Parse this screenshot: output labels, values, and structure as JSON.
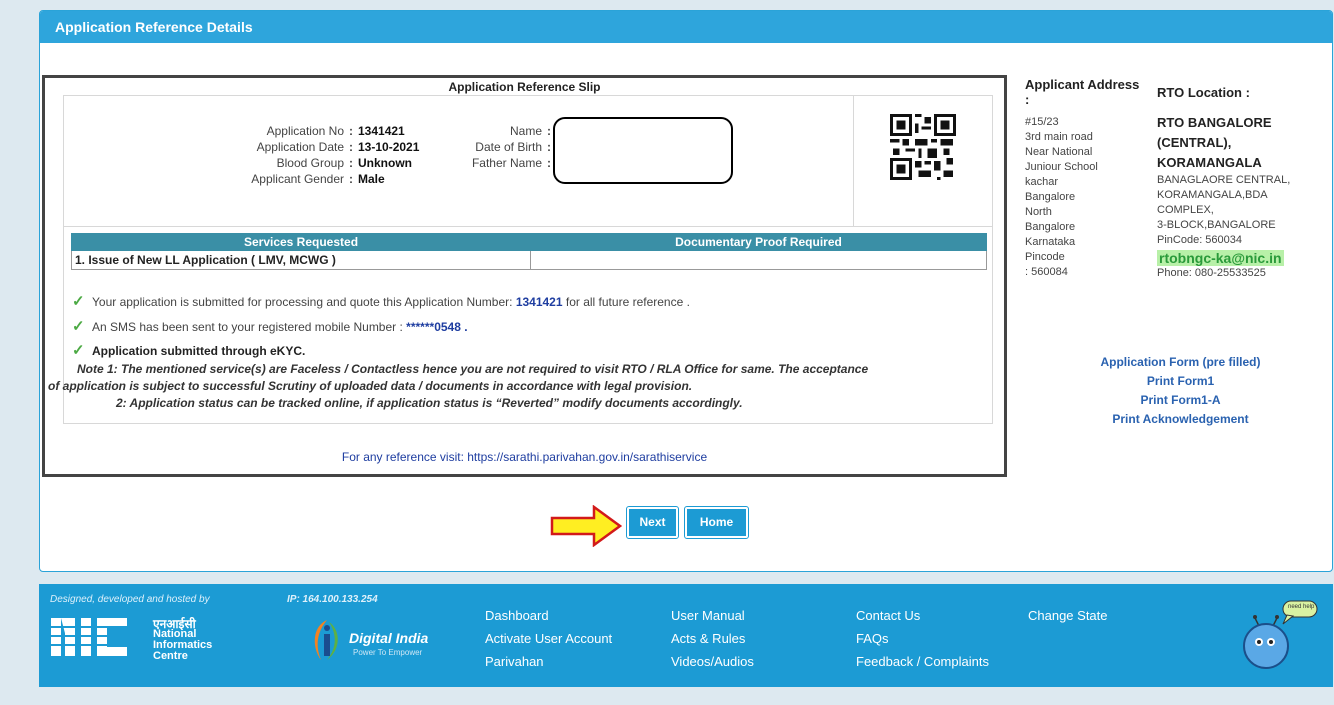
{
  "panel": {
    "title": "Application Reference Details"
  },
  "slip": {
    "title": "Application Reference Slip",
    "left_fields": [
      {
        "label": "Application No",
        "value": "1341421"
      },
      {
        "label": "Application Date",
        "value": "13-10-2021"
      },
      {
        "label": "Blood Group",
        "value": "Unknown"
      },
      {
        "label": "Applicant Gender",
        "value": "Male"
      }
    ],
    "mid_fields": [
      {
        "label": "Name"
      },
      {
        "label": "Date of Birth"
      },
      {
        "label": "Father Name"
      }
    ],
    "colon": ":",
    "services": {
      "headers": [
        "Services Requested",
        "Documentary Proof Required"
      ],
      "rows": [
        [
          "1. Issue of New LL Application ( LMV, MCWG )",
          ""
        ]
      ]
    },
    "messages": {
      "m1_prefix": "Your application is submitted for processing and quote this Application Number:",
      "m1_number": "1341421",
      "m1_suffix": "for all future reference .",
      "m2_prefix": "An SMS has been sent to your registered mobile Number :",
      "m2_number": "******0548 .",
      "m3": "Application submitted through eKYC."
    },
    "notes": {
      "n1a": "Note 1:  The mentioned service(s) are Faceless / Contactless hence you are not required to visit RTO / RLA Office for same. The acceptance",
      "n1b": "of application is subject to successful Scrutiny of uploaded data / documents in accordance with legal provision.",
      "n2": "2:  Application status can be tracked online, if application status is “Reverted” modify documents accordingly."
    },
    "reference": "For any reference visit: https://sarathi.parivahan.gov.in/sarathiservice"
  },
  "address": {
    "heading": "Applicant Address :",
    "lines": [
      "#15/23",
      "3rd main road",
      "Near National",
      "Juniour School",
      "kachar",
      "Bangalore",
      "North",
      "Bangalore",
      "Karnataka",
      "Pincode",
      ": 560084"
    ]
  },
  "rto": {
    "heading": "RTO Location :",
    "name": "RTO BANGALORE (CENTRAL), KORAMANGALA",
    "lines": [
      "BANAGLAORE CENTRAL,",
      "KORAMANGALA,BDA",
      "COMPLEX,",
      "3-BLOCK,BANGALORE",
      "PinCode: 560034"
    ],
    "email": "rtobngc-ka@nic.in",
    "phone": "Phone: 080-25533525"
  },
  "links": [
    "Application Form (pre filled)",
    "Print Form1",
    "Print Form1-A",
    "Print Acknowledgement"
  ],
  "buttons": {
    "next": "Next",
    "home": "Home"
  },
  "footer": {
    "designed_by": "Designed, developed and hosted by",
    "ip": "IP: 164.100.133.254",
    "nic": {
      "hindi": "एनआईसी",
      "line1": "National",
      "line2": "Informatics",
      "line3": "Centre"
    },
    "digital_india": {
      "name": "Digital India",
      "tagline": "Power To Empower"
    },
    "col1": [
      "Dashboard",
      "Activate User Account",
      "Parivahan"
    ],
    "col2": [
      "User Manual",
      "Acts & Rules",
      "Videos/Audios"
    ],
    "col3": [
      "Contact Us",
      "FAQs",
      "Feedback / Complaints"
    ],
    "col4": [
      "Change State"
    ],
    "mascot_bubble": "need help"
  },
  "colors": {
    "accent": "#1c9bd4",
    "header": "#2ea5dc",
    "table_header": "#3a8fa6",
    "email_bg": "#b8f0a8"
  }
}
